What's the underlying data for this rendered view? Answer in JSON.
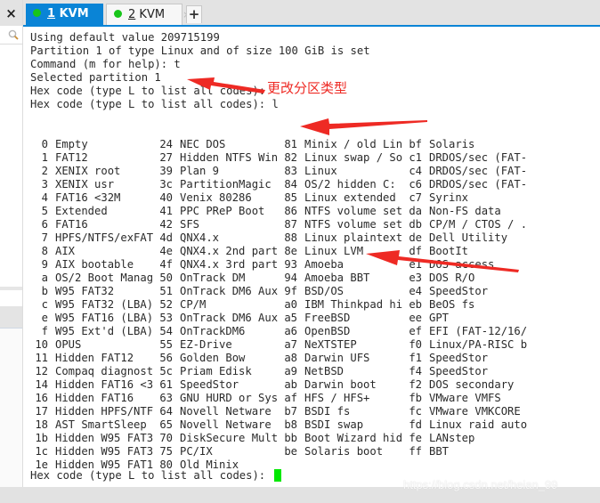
{
  "sidebar": {
    "close_label": "×",
    "search_icon": "search-icon"
  },
  "tabs": [
    {
      "number": "1",
      "label": " KVM",
      "close": "×",
      "status_color": "#18c51a",
      "active": true
    },
    {
      "number": "2",
      "label": " KVM",
      "close": "×",
      "status_color": "#18c51a",
      "active": false
    }
  ],
  "add_tab_label": "+",
  "terminal": {
    "lines": [
      "Using default value 209715199",
      "Partition 1 of type Linux and of size 100 GiB is set",
      "",
      "Command (m for help): t",
      "Selected partition 1",
      "Hex code (type L to list all codes):",
      "Hex code (type L to list all codes): l"
    ],
    "partition_types": [
      [
        [
          "0",
          "Empty"
        ],
        [
          "24",
          "NEC DOS"
        ],
        [
          "81",
          "Minix / old Lin"
        ],
        [
          "bf",
          "Solaris"
        ]
      ],
      [
        [
          "1",
          "FAT12"
        ],
        [
          "27",
          "Hidden NTFS Win"
        ],
        [
          "82",
          "Linux swap / So"
        ],
        [
          "c1",
          "DRDOS/sec (FAT-"
        ]
      ],
      [
        [
          "2",
          "XENIX root"
        ],
        [
          "39",
          "Plan 9"
        ],
        [
          "83",
          "Linux"
        ],
        [
          "c4",
          "DRDOS/sec (FAT-"
        ]
      ],
      [
        [
          "3",
          "XENIX usr"
        ],
        [
          "3c",
          "PartitionMagic"
        ],
        [
          "84",
          "OS/2 hidden C:"
        ],
        [
          "c6",
          "DRDOS/sec (FAT-"
        ]
      ],
      [
        [
          "4",
          "FAT16 <32M"
        ],
        [
          "40",
          "Venix 80286"
        ],
        [
          "85",
          "Linux extended"
        ],
        [
          "c7",
          "Syrinx"
        ]
      ],
      [
        [
          "5",
          "Extended"
        ],
        [
          "41",
          "PPC PReP Boot"
        ],
        [
          "86",
          "NTFS volume set"
        ],
        [
          "da",
          "Non-FS data"
        ]
      ],
      [
        [
          "6",
          "FAT16"
        ],
        [
          "42",
          "SFS"
        ],
        [
          "87",
          "NTFS volume set"
        ],
        [
          "db",
          "CP/M / CTOS / ."
        ]
      ],
      [
        [
          "7",
          "HPFS/NTFS/exFAT"
        ],
        [
          "4d",
          "QNX4.x"
        ],
        [
          "88",
          "Linux plaintext"
        ],
        [
          "de",
          "Dell Utility"
        ]
      ],
      [
        [
          "8",
          "AIX"
        ],
        [
          "4e",
          "QNX4.x 2nd part"
        ],
        [
          "8e",
          "Linux LVM"
        ],
        [
          "df",
          "BootIt"
        ]
      ],
      [
        [
          "9",
          "AIX bootable"
        ],
        [
          "4f",
          "QNX4.x 3rd part"
        ],
        [
          "93",
          "Amoeba"
        ],
        [
          "e1",
          "DOS access"
        ]
      ],
      [
        [
          "a",
          "OS/2 Boot Manag"
        ],
        [
          "50",
          "OnTrack DM"
        ],
        [
          "94",
          "Amoeba BBT"
        ],
        [
          "e3",
          "DOS R/O"
        ]
      ],
      [
        [
          "b",
          "W95 FAT32"
        ],
        [
          "51",
          "OnTrack DM6 Aux"
        ],
        [
          "9f",
          "BSD/OS"
        ],
        [
          "e4",
          "SpeedStor"
        ]
      ],
      [
        [
          "c",
          "W95 FAT32 (LBA)"
        ],
        [
          "52",
          "CP/M"
        ],
        [
          "a0",
          "IBM Thinkpad hi"
        ],
        [
          "eb",
          "BeOS fs"
        ]
      ],
      [
        [
          "e",
          "W95 FAT16 (LBA)"
        ],
        [
          "53",
          "OnTrack DM6 Aux"
        ],
        [
          "a5",
          "FreeBSD"
        ],
        [
          "ee",
          "GPT"
        ]
      ],
      [
        [
          "f",
          "W95 Ext'd (LBA)"
        ],
        [
          "54",
          "OnTrackDM6"
        ],
        [
          "a6",
          "OpenBSD"
        ],
        [
          "ef",
          "EFI (FAT-12/16/"
        ]
      ],
      [
        [
          "10",
          "OPUS"
        ],
        [
          "55",
          "EZ-Drive"
        ],
        [
          "a7",
          "NeXTSTEP"
        ],
        [
          "f0",
          "Linux/PA-RISC b"
        ]
      ],
      [
        [
          "11",
          "Hidden FAT12"
        ],
        [
          "56",
          "Golden Bow"
        ],
        [
          "a8",
          "Darwin UFS"
        ],
        [
          "f1",
          "SpeedStor"
        ]
      ],
      [
        [
          "12",
          "Compaq diagnost"
        ],
        [
          "5c",
          "Priam Edisk"
        ],
        [
          "a9",
          "NetBSD"
        ],
        [
          "f4",
          "SpeedStor"
        ]
      ],
      [
        [
          "14",
          "Hidden FAT16 <3"
        ],
        [
          "61",
          "SpeedStor"
        ],
        [
          "ab",
          "Darwin boot"
        ],
        [
          "f2",
          "DOS secondary"
        ]
      ],
      [
        [
          "16",
          "Hidden FAT16"
        ],
        [
          "63",
          "GNU HURD or Sys"
        ],
        [
          "af",
          "HFS / HFS+"
        ],
        [
          "fb",
          "VMware VMFS"
        ]
      ],
      [
        [
          "17",
          "Hidden HPFS/NTF"
        ],
        [
          "64",
          "Novell Netware"
        ],
        [
          "b7",
          "BSDI fs"
        ],
        [
          "fc",
          "VMware VMKCORE"
        ]
      ],
      [
        [
          "18",
          "AST SmartSleep"
        ],
        [
          "65",
          "Novell Netware"
        ],
        [
          "b8",
          "BSDI swap"
        ],
        [
          "fd",
          "Linux raid auto"
        ]
      ],
      [
        [
          "1b",
          "Hidden W95 FAT3"
        ],
        [
          "70",
          "DiskSecure Mult"
        ],
        [
          "bb",
          "Boot Wizard hid"
        ],
        [
          "fe",
          "LANstep"
        ]
      ],
      [
        [
          "1c",
          "Hidden W95 FAT3"
        ],
        [
          "75",
          "PC/IX"
        ],
        [
          "be",
          "Solaris boot"
        ],
        [
          "ff",
          "BBT"
        ]
      ],
      [
        [
          "1e",
          "Hidden W95 FAT1"
        ],
        [
          "80",
          "Old Minix"
        ]
      ]
    ],
    "final_prompt": "Hex code (type L to list all codes): ",
    "cursor_color": "#00e800"
  },
  "annotation": {
    "label": "更改分区类型",
    "arrow_color": "#ee2a24"
  },
  "watermark": "https://blog.csdn.net/heian_99"
}
